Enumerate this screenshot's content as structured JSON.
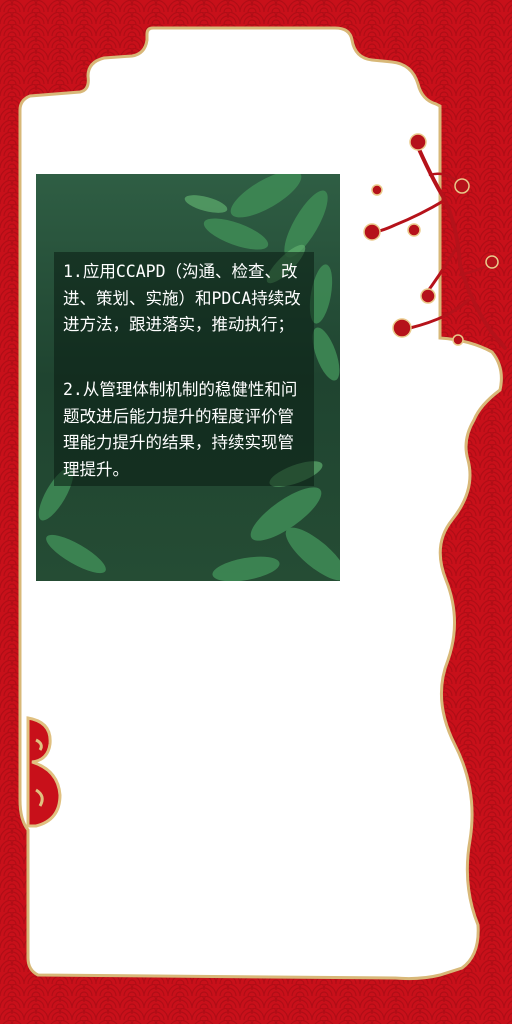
{
  "colors": {
    "background_red": "#c8101a",
    "panel_white": "#ffffff",
    "gold_outline": "#d8b878",
    "card_green": "#2b5a3a",
    "text": "#ffffff"
  },
  "content": {
    "paragraph_1": "1.应用CCAPD（沟通、检查、改进、策划、实施）和PDCA持续改进方法，跟进落实，推动执行；",
    "paragraph_2": "2.从管理体制机制的稳健性和问题改进后能力提升的程度评价管理能力提升的结果，持续实现管理提升。"
  },
  "decorations": [
    "plum-blossom-branch",
    "auspicious-cloud",
    "wave-pattern",
    "leaf-photo"
  ]
}
